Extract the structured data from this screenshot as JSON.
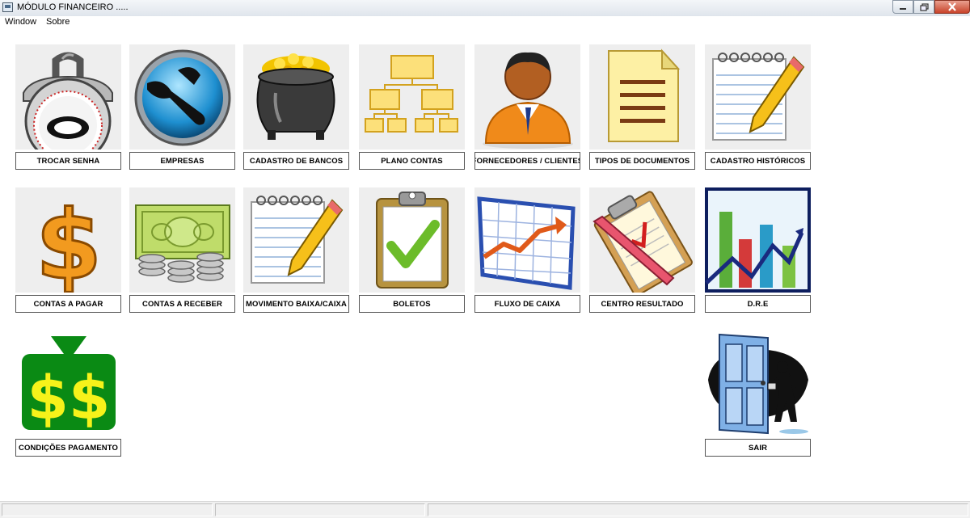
{
  "window": {
    "title": "MÓDULO FINANCEIRO .....",
    "controls": [
      "minimize-icon",
      "restore-icon",
      "close-icon"
    ]
  },
  "menubar": {
    "items": [
      {
        "label": "Window"
      },
      {
        "label": "Sobre"
      }
    ]
  },
  "tiles": [
    {
      "label": "TROCAR SENHA",
      "icon": "padlock-icon"
    },
    {
      "label": "EMPRESAS",
      "icon": "wrench-icon"
    },
    {
      "label": "CADASTRO DE BANCOS",
      "icon": "pot-of-gold-icon"
    },
    {
      "label": "PLANO CONTAS",
      "icon": "org-chart-icon"
    },
    {
      "label": "FORNECEDORES / CLIENTES",
      "icon": "businessman-icon"
    },
    {
      "label": "TIPOS DE DOCUMENTOS",
      "icon": "document-icon"
    },
    {
      "label": "CADASTRO HISTÓRICOS",
      "icon": "notepad-pencil-icon"
    },
    {
      "label": "CONTAS A PAGAR",
      "icon": "dollar-sign-icon"
    },
    {
      "label": "CONTAS A RECEBER",
      "icon": "money-coins-icon"
    },
    {
      "label": "MOVIMENTO BAIXA/CAIXA",
      "icon": "notepad-pencil-icon"
    },
    {
      "label": "BOLETOS",
      "icon": "clipboard-check-icon"
    },
    {
      "label": "FLUXO DE CAIXA",
      "icon": "rising-chart-icon"
    },
    {
      "label": "CENTRO RESULTADO",
      "icon": "clipboard-pencil-icon"
    },
    {
      "label": "D.R.E",
      "icon": "bar-chart-icon"
    },
    {
      "label": "CONDIÇÕES PAGAMENTO",
      "icon": "money-bag-icon"
    },
    {
      "label": "SAIR",
      "icon": "exit-door-icon"
    }
  ],
  "statusbar": {
    "panels": [
      "",
      "",
      ""
    ]
  }
}
